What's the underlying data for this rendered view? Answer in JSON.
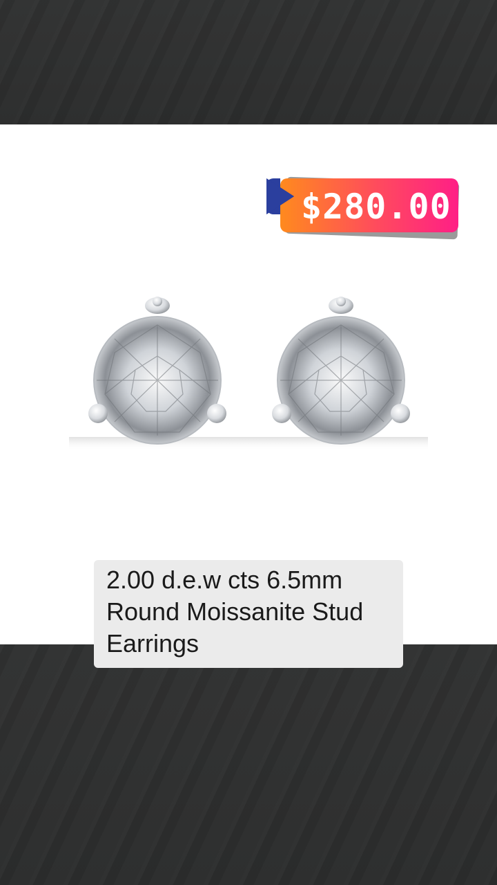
{
  "product": {
    "price": "$280.00",
    "title": "2.00 d.e.w cts 6.5mm Round Moissanite Stud Earrings",
    "image_alt": "Round moissanite stud earrings with three prongs"
  },
  "colors": {
    "price_gradient_start": "#ff8a1e",
    "price_gradient_end": "#ff1f86",
    "play_marker": "#2b3f9e",
    "title_box": "#ebebeb"
  }
}
